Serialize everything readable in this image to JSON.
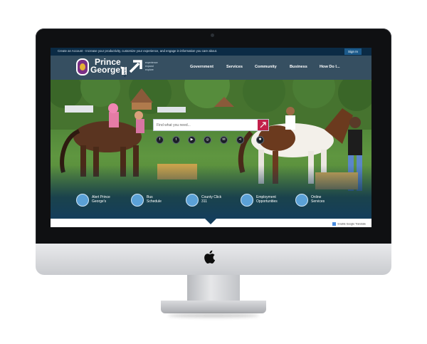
{
  "topbar": {
    "message": "Create an Account - Increase your productivity, customize your experience, and engage in information you care about.",
    "signin_label": "Sign In"
  },
  "logo": {
    "name_line1": "Prince",
    "name_line2": "George's",
    "county_label": "COUNTY",
    "tagline": [
      "experience",
      "expand",
      "explore"
    ]
  },
  "nav": {
    "items": [
      "Government",
      "Services",
      "Community",
      "Business",
      "How Do I..."
    ]
  },
  "search": {
    "placeholder": "Find what you need..."
  },
  "social": {
    "icons": [
      "facebook-icon",
      "twitter-icon",
      "youtube-icon",
      "instagram-icon",
      "email-icon",
      "share-icon",
      "settings-icon"
    ]
  },
  "quick_links": [
    {
      "line1": "Alert Prince",
      "line2": "George's",
      "icon": "chat-alert-icon"
    },
    {
      "line1": "Bus",
      "line2": "Schedule",
      "icon": "bus-icon"
    },
    {
      "line1": "County Click",
      "line2": "311",
      "icon": "laptop-icon"
    },
    {
      "line1": "Employment",
      "line2": "Opportunities",
      "icon": "briefcase-icon"
    },
    {
      "line1": "Online",
      "line2": "Services",
      "icon": "cursor-click-icon"
    }
  ],
  "translate": {
    "label": "Enable Google Translate"
  },
  "colors": {
    "header_bg": "#0a283e",
    "accent_pink": "#c2204a",
    "quick_icon_blue": "#5ba1d7",
    "logo_purple": "#7a2f86",
    "logo_gold": "#e5b136"
  }
}
